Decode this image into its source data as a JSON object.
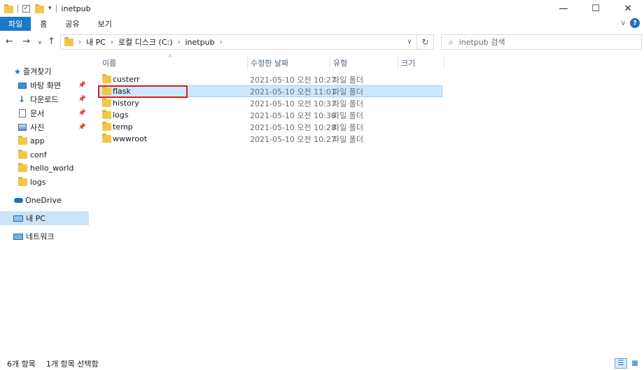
{
  "window": {
    "title": "inetpub"
  },
  "ribbon": {
    "tabs": [
      "파일",
      "홈",
      "공유",
      "보기"
    ]
  },
  "address": {
    "crumbs": [
      "내 PC",
      "로컬 디스크 (C:)",
      "inetpub"
    ],
    "search_placeholder": "inetpub 검색"
  },
  "sidebar": {
    "quick_access": "즐겨찾기",
    "items": [
      {
        "label": "바탕 화면",
        "icon": "desktop-icon",
        "pinned": true
      },
      {
        "label": "다운로드",
        "icon": "download-icon",
        "pinned": true
      },
      {
        "label": "문서",
        "icon": "document-icon",
        "pinned": true
      },
      {
        "label": "사진",
        "icon": "picture-icon",
        "pinned": true
      },
      {
        "label": "app",
        "icon": "folder-icon",
        "pinned": false
      },
      {
        "label": "conf",
        "icon": "folder-icon",
        "pinned": false
      },
      {
        "label": "hello_world",
        "icon": "folder-icon",
        "pinned": false
      },
      {
        "label": "logs",
        "icon": "folder-icon",
        "pinned": false
      }
    ],
    "onedrive": "OneDrive",
    "this_pc": "내 PC",
    "network": "네트워크"
  },
  "columns": {
    "name": "이름",
    "modified": "수정한 날짜",
    "type": "유형",
    "size": "크기"
  },
  "files": [
    {
      "name": "custerr",
      "modified": "2021-05-10 오전 10:27",
      "type": "파일 폴더",
      "selected": false
    },
    {
      "name": "flask",
      "modified": "2021-05-10 오전 11:01",
      "type": "파일 폴더",
      "selected": true
    },
    {
      "name": "history",
      "modified": "2021-05-10 오전 10:37",
      "type": "파일 폴더",
      "selected": false
    },
    {
      "name": "logs",
      "modified": "2021-05-10 오전 10:36",
      "type": "파일 폴더",
      "selected": false
    },
    {
      "name": "temp",
      "modified": "2021-05-10 오전 10:28",
      "type": "파일 폴더",
      "selected": false
    },
    {
      "name": "wwwroot",
      "modified": "2021-05-10 오전 10:27",
      "type": "파일 폴더",
      "selected": false
    }
  ],
  "status": {
    "item_count": "6개 항목",
    "selected_count": "1개 항목 선택함"
  },
  "colors": {
    "accent": "#1979ca",
    "selection": "#cce8ff",
    "highlight_box": "#d81e1e",
    "folder": "#f3c74a"
  }
}
